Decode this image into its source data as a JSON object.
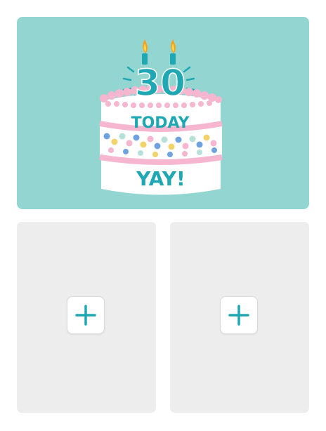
{
  "card": {
    "title_number": "30",
    "line1": "TODAY",
    "line2": "YAY!"
  },
  "colors": {
    "card_background": "#93d6d1",
    "accent_teal": "#1fa8b4",
    "frosting_pink": "#f6b6cf",
    "cake_white": "#ffffff",
    "slot_background": "#ededed"
  },
  "slots": [
    {
      "icon": "plus-icon"
    },
    {
      "icon": "plus-icon"
    }
  ]
}
